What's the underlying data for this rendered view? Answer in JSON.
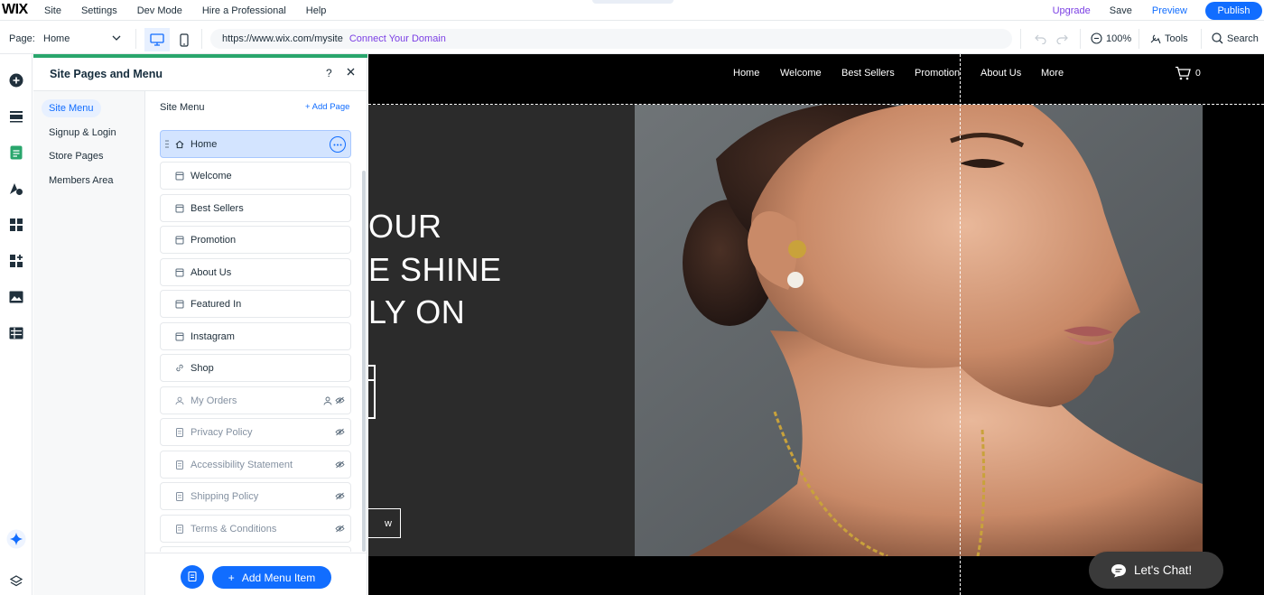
{
  "topbar": {
    "logo": "WIX",
    "menu": [
      "Site",
      "Settings",
      "Dev Mode",
      "Hire a Professional",
      "Help"
    ],
    "upgrade": "Upgrade",
    "save": "Save",
    "preview": "Preview",
    "publish": "Publish"
  },
  "toolbar": {
    "page_label": "Page:",
    "page_value": "Home",
    "url": "https://www.wix.com/mysite",
    "connect_domain": "Connect Your Domain",
    "zoom": "100%",
    "tools": "Tools",
    "search": "Search"
  },
  "panel": {
    "title": "Site Pages and Menu",
    "help": "?",
    "categories": [
      "Site Menu",
      "Signup & Login",
      "Store Pages",
      "Members Area"
    ],
    "content_title": "Site Menu",
    "add_page": "+ Add Page",
    "items": [
      {
        "label": "Home",
        "icon": "home-icon",
        "selected": true
      },
      {
        "label": "Welcome",
        "icon": "page-icon"
      },
      {
        "label": "Best Sellers",
        "icon": "page-icon"
      },
      {
        "label": "Promotion",
        "icon": "page-icon"
      },
      {
        "label": "About Us",
        "icon": "page-icon"
      },
      {
        "label": "Featured In",
        "icon": "page-icon"
      },
      {
        "label": "Instagram",
        "icon": "page-icon"
      },
      {
        "label": "Shop",
        "icon": "link-icon"
      },
      {
        "label": "My Orders",
        "icon": "members-icon",
        "hidden": true,
        "locked": true
      },
      {
        "label": "Privacy Policy",
        "icon": "page-icon",
        "hidden": true
      },
      {
        "label": "Accessibility Statement",
        "icon": "page-icon",
        "hidden": true
      },
      {
        "label": "Shipping Policy",
        "icon": "page-icon",
        "hidden": true
      },
      {
        "label": "Terms & Conditions",
        "icon": "page-icon",
        "hidden": true
      }
    ],
    "add_menu_item": "Add Menu Item"
  },
  "site": {
    "nav": [
      "Home",
      "Welcome",
      "Best Sellers",
      "Promotion",
      "About Us",
      "More"
    ],
    "cart_count": "0",
    "hero_lines": [
      "OUR",
      "E SHINE",
      "LY ON"
    ],
    "hero_button": "w",
    "chat": "Let's Chat!"
  },
  "colors": {
    "accent": "#116dff",
    "upgrade": "#7b3fe4",
    "panel_accent": "#29a66c"
  }
}
